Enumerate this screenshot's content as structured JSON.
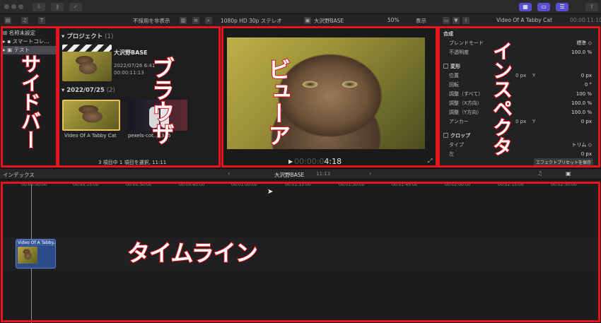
{
  "toolbar": {
    "hide_rejected": "不採用を非表示",
    "format": "1080p HD 30p ステレオ",
    "project": "大沢野BASE",
    "zoom": "50%",
    "view": "表示",
    "clip_name": "Video Of A Tabby Cat",
    "duration": "00:00:11:10"
  },
  "sidebar": {
    "items": [
      {
        "label": "名称未設定"
      },
      {
        "label": "スマートコレ..."
      },
      {
        "label": "テスト"
      }
    ]
  },
  "browser": {
    "project_header": "プロジェクト",
    "project_count": "(1)",
    "project_name": "大沢野BASE",
    "project_date": "2022/07/26 6:41",
    "project_duration": "00:00:11:13",
    "date_header": "2022/07/25",
    "date_count": "(2)",
    "clips": [
      {
        "label": "Video Of A Tabby Cat"
      },
      {
        "label": "pexels-cot...2366"
      }
    ],
    "status": "3 項目中 1 項目を選択, 11:11"
  },
  "viewer": {
    "timecode_dim": "00:00:0",
    "timecode": "4:18"
  },
  "inspector": {
    "composite": "合成",
    "blend_mode_label": "ブレンドモード",
    "blend_mode_value": "標準 ◇",
    "opacity_label": "不透明度",
    "opacity_value": "100.0 %",
    "transform": "変形",
    "position_label": "位置",
    "position_x": "0 px",
    "position_y_label": "Y",
    "position_y": "0 px",
    "rotation_label": "回転",
    "rotation_value": "0 °",
    "scale_all_label": "調整（すべて）",
    "scale_all_value": "100 %",
    "scale_x_label": "調整（X方向）",
    "scale_x_value": "100.0 %",
    "scale_y_label": "調整（Y方向）",
    "scale_y_value": "100.0 %",
    "anchor_label": "アンカー",
    "anchor_x": "0 px",
    "anchor_y_label": "Y",
    "anchor_y": "0 px",
    "crop": "クロップ",
    "type_label": "タイプ",
    "type_value": "トリム ◇",
    "left_label": "左",
    "left_value": "0 px",
    "save_preset": "エフェクトプリセットを保存"
  },
  "timeline_bar": {
    "index": "インデックス",
    "project": "大沢野BASE",
    "duration": "11:13"
  },
  "timeline": {
    "ticks": [
      "00:00:00:00",
      "00:00:15:00",
      "00:00:30:00",
      "00:00:45:00",
      "00:01:00:00",
      "00:01:15:00",
      "00:01:30:00",
      "00:01:45:00",
      "00:02:00:00",
      "00:02:15:00",
      "00:02:30:00"
    ],
    "clip_label": "Video Of A Tabby..."
  },
  "overlays": {
    "sidebar": "サイドバー",
    "browser": "ブラウザ",
    "viewer": "ビューア",
    "inspector": "インスペクタ",
    "timeline": "タイムライン"
  },
  "colors": {
    "highlight_box": "#e8141c",
    "accent": "#5a4fd0",
    "clip": "#2d4a8a"
  }
}
